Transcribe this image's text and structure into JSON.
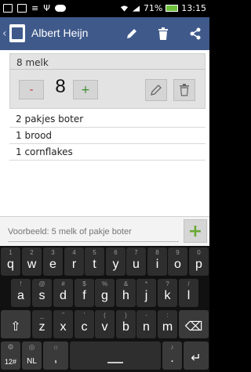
{
  "status_bar": {
    "battery": "71%",
    "time": "13:15",
    "left_icons": [
      "message-icon",
      "image-icon",
      "menu-icon",
      "usb-icon",
      "cloud-icon"
    ],
    "right_icons": [
      "wifi-icon",
      "signal-icon",
      "battery-icon"
    ]
  },
  "action_bar": {
    "title": "Albert Heijn",
    "back_icon": "‹",
    "actions": [
      "edit",
      "delete",
      "share"
    ]
  },
  "selected_item": {
    "title": "8 melk",
    "quantity": "8",
    "minus_label": "-",
    "plus_label": "+"
  },
  "list": {
    "items": [
      {
        "label": "2 pakjes boter"
      },
      {
        "label": "1 brood"
      },
      {
        "label": "1 cornflakes"
      }
    ]
  },
  "input": {
    "placeholder": "Voorbeeld: 5 melk of pakje boter",
    "add_label": "+"
  },
  "keyboard": {
    "row1": [
      {
        "main": "q",
        "hint": "1"
      },
      {
        "main": "w",
        "hint": "2"
      },
      {
        "main": "e",
        "hint": "3"
      },
      {
        "main": "r",
        "hint": "4"
      },
      {
        "main": "t",
        "hint": "5"
      },
      {
        "main": "y",
        "hint": "6"
      },
      {
        "main": "u",
        "hint": "7"
      },
      {
        "main": "i",
        "hint": "8"
      },
      {
        "main": "o",
        "hint": "9"
      },
      {
        "main": "p",
        "hint": "0"
      }
    ],
    "row2": [
      {
        "main": "a",
        "hint": "!"
      },
      {
        "main": "s",
        "hint": "@"
      },
      {
        "main": "d",
        "hint": "#"
      },
      {
        "main": "f",
        "hint": "$"
      },
      {
        "main": "g",
        "hint": "%"
      },
      {
        "main": "h",
        "hint": "&"
      },
      {
        "main": "j",
        "hint": "*"
      },
      {
        "main": "k",
        "hint": "?"
      },
      {
        "main": "l",
        "hint": "/"
      }
    ],
    "row3": [
      {
        "main": "⇧",
        "hint": ""
      },
      {
        "main": "z",
        "hint": "_"
      },
      {
        "main": "x",
        "hint": "\""
      },
      {
        "main": "c",
        "hint": "'"
      },
      {
        "main": "v",
        "hint": "("
      },
      {
        "main": "b",
        "hint": ")"
      },
      {
        "main": "n",
        "hint": "-"
      },
      {
        "main": "m",
        "hint": ":"
      },
      {
        "main": "⌫",
        "hint": ""
      }
    ],
    "row4": {
      "sym": "12#",
      "lang": "NL",
      "comma": ",",
      "space": "",
      "period": ".",
      "enter": "↵"
    }
  }
}
